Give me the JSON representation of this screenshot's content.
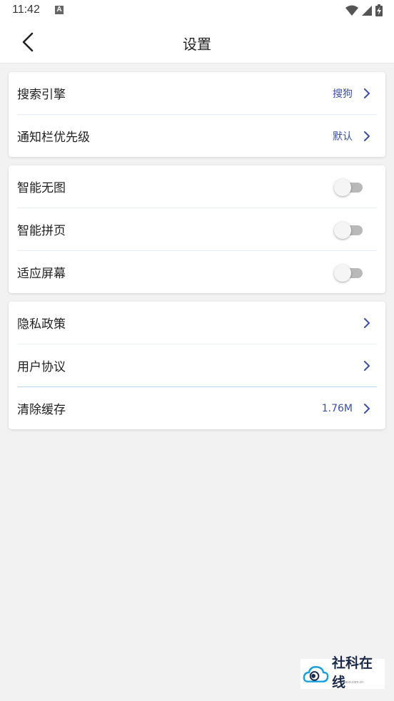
{
  "status_bar": {
    "time": "11:42",
    "notification_icon": "a-icon",
    "icons": [
      "wifi-icon",
      "cellular-icon",
      "battery-charging-icon"
    ]
  },
  "header": {
    "title": "设置",
    "back_icon": "chevron-left-icon"
  },
  "groups": [
    {
      "items": [
        {
          "label": "搜索引擎",
          "value": "搜狗",
          "type": "link"
        },
        {
          "label": "通知栏优先级",
          "value": "默认",
          "type": "link"
        }
      ]
    },
    {
      "items": [
        {
          "label": "智能无图",
          "type": "toggle",
          "on": false
        },
        {
          "label": "智能拼页",
          "type": "toggle",
          "on": false
        },
        {
          "label": "适应屏幕",
          "type": "toggle",
          "on": false
        }
      ]
    },
    {
      "items": [
        {
          "label": "隐私政策",
          "value": "",
          "type": "link"
        },
        {
          "label": "用户协议",
          "value": "",
          "type": "link"
        },
        {
          "label": "清除缓存",
          "value": "1.76M",
          "type": "link"
        }
      ]
    }
  ],
  "watermark": {
    "text": "社科在线",
    "sub": "caso.com.cn"
  },
  "colors": {
    "accent": "#3b4fa0",
    "background": "#f2f2f2",
    "card": "#ffffff"
  }
}
